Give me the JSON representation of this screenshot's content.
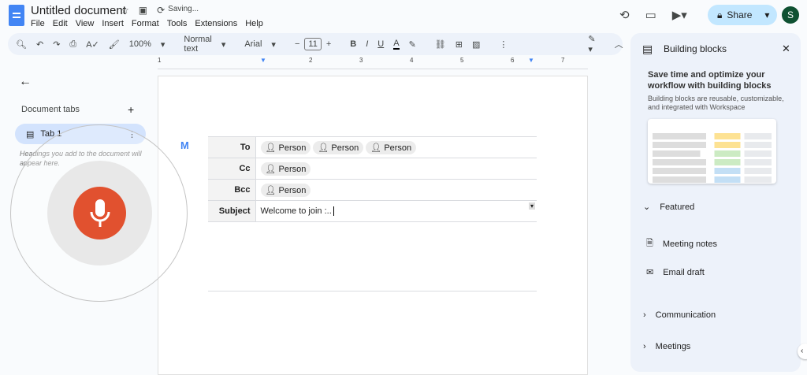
{
  "header": {
    "title": "Untitled document",
    "status": "Saving...",
    "menu": [
      "File",
      "Edit",
      "View",
      "Insert",
      "Format",
      "Tools",
      "Extensions",
      "Help"
    ],
    "share": "Share",
    "avatar": "S"
  },
  "toolbar": {
    "zoom": "100%",
    "style": "Normal text",
    "font": "Arial",
    "size": "11"
  },
  "ruler": [
    "1",
    "1",
    "2",
    "3",
    "4",
    "5",
    "6",
    "7"
  ],
  "sidebar": {
    "doc_tabs": "Document tabs",
    "tab": "Tab 1",
    "hint": "Headings you add to the document will appear here."
  },
  "email": {
    "rows": [
      {
        "label": "To",
        "chips": [
          "Person",
          "Person",
          "Person"
        ]
      },
      {
        "label": "Cc",
        "chips": [
          "Person"
        ]
      },
      {
        "label": "Bcc",
        "chips": [
          "Person"
        ]
      }
    ],
    "subject_label": "Subject",
    "subject": "Welcome to join :.."
  },
  "panel": {
    "title": "Building blocks",
    "headline": "Save time and optimize your workflow with building blocks",
    "desc": "Building blocks are reusable, customizable, and integrated with Workspace",
    "featured": "Featured",
    "items": [
      "Meeting notes",
      "Email draft"
    ],
    "sections": [
      "Communication",
      "Meetings"
    ]
  },
  "colors": {
    "accent": "#0b57d0",
    "mic": "#e1512f",
    "share_bg": "#c2e7ff"
  }
}
